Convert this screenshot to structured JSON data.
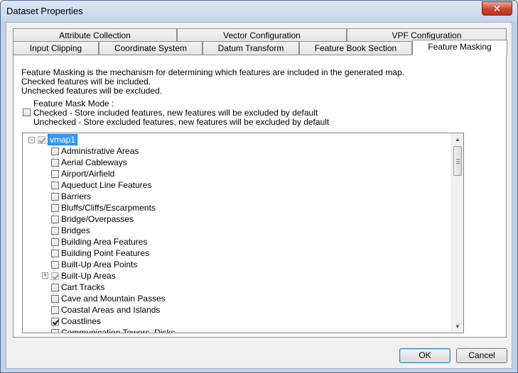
{
  "window": {
    "title": "Dataset Properties",
    "close_label": "✕"
  },
  "tabs": {
    "row_top": [
      {
        "label": "Attribute Collection"
      },
      {
        "label": "Vector Configuration"
      },
      {
        "label": "VPF Configuration"
      }
    ],
    "row_bottom": [
      {
        "label": "Input Clipping"
      },
      {
        "label": "Coordinate System"
      },
      {
        "label": "Datum Transform"
      },
      {
        "label": "Feature Book Section"
      },
      {
        "label": "Feature Masking"
      }
    ],
    "active": "Feature Masking"
  },
  "description": {
    "line1": "Feature Masking is the mechanism for determining which features are included in the generated map.",
    "line2": "Checked features will be included.",
    "line3": "Unchecked features will be excluded."
  },
  "mask_mode": {
    "label": "Feature Mask Mode :",
    "checked_text": "Checked - Store included features, new features will be excluded by default",
    "unchecked_text": "Unchecked - Store excluded features, new features will be excluded by default",
    "checked": false
  },
  "tree": {
    "root": {
      "label": "vmap1",
      "state": "partial",
      "expanded": true
    },
    "items": [
      {
        "label": "Administrative Areas",
        "checked": false
      },
      {
        "label": "Aerial Cableways",
        "checked": false
      },
      {
        "label": "Airport/Airfield",
        "checked": false
      },
      {
        "label": "Aqueduct Line Features",
        "checked": false
      },
      {
        "label": "Barriers",
        "checked": false
      },
      {
        "label": "Bluffs/Cliffs/Escarpments",
        "checked": false
      },
      {
        "label": "Bridge/Overpasses",
        "checked": false
      },
      {
        "label": "Bridges",
        "checked": false
      },
      {
        "label": "Building Area Features",
        "checked": false
      },
      {
        "label": "Building Point Features",
        "checked": false
      },
      {
        "label": "Built-Up Area Points",
        "checked": false
      },
      {
        "label": "Built-Up Areas",
        "checked": "partial",
        "expandable": true
      },
      {
        "label": "Cart Tracks",
        "checked": false
      },
      {
        "label": "Cave and Mountain Passes",
        "checked": false
      },
      {
        "label": "Coastal Areas and Islands",
        "checked": false
      },
      {
        "label": "Coastlines",
        "checked": true
      },
      {
        "label": "Communication Towers, Disks",
        "checked": false
      }
    ]
  },
  "buttons": {
    "ok": "OK",
    "cancel": "Cancel"
  }
}
